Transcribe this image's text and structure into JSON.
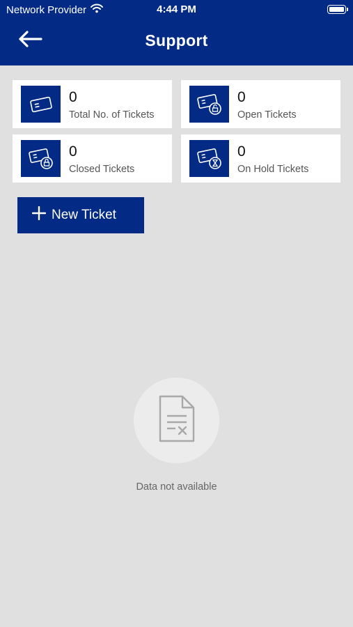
{
  "status_bar": {
    "carrier": "Network Provider",
    "time": "4:44 PM"
  },
  "header": {
    "title": "Support",
    "back_icon": "arrow-left-icon"
  },
  "summary_cards": [
    {
      "count": "0",
      "label": "Total No. of Tickets",
      "icon": "ticket-icon"
    },
    {
      "count": "0",
      "label": "Open Tickets",
      "icon": "ticket-unlock-icon"
    },
    {
      "count": "0",
      "label": "Closed Tickets",
      "icon": "ticket-lock-icon"
    },
    {
      "count": "0",
      "label": "On Hold Tickets",
      "icon": "ticket-hourglass-icon"
    }
  ],
  "actions": {
    "new_ticket_label": "New Ticket"
  },
  "empty_state": {
    "message": "Data not available",
    "icon": "document-x-icon"
  },
  "colors": {
    "primary": "#032b85",
    "background": "#e0e0e0",
    "card": "#ffffff"
  }
}
